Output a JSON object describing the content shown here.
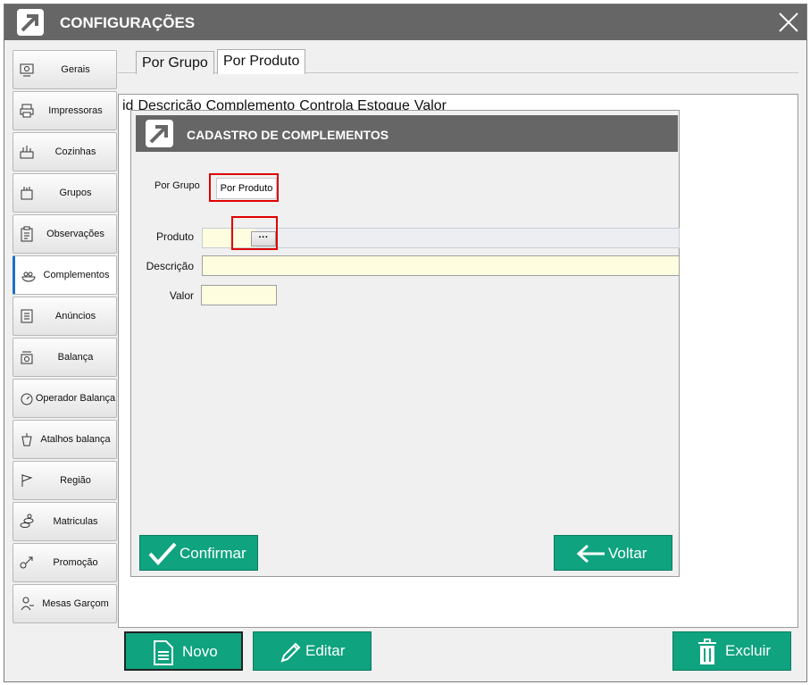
{
  "window": {
    "title": "CONFIGURAÇÕES"
  },
  "sidebar": {
    "items": [
      {
        "label": "Gerais",
        "icon": "settings-panel-icon"
      },
      {
        "label": "Impressoras",
        "icon": "printer-icon"
      },
      {
        "label": "Cozinhas",
        "icon": "kitchen-icon"
      },
      {
        "label": "Grupos",
        "icon": "groups-icon"
      },
      {
        "label": "Observações",
        "icon": "clipboard-icon"
      },
      {
        "label": "Complementos",
        "icon": "dish-icon"
      },
      {
        "label": "Anúncios",
        "icon": "document-icon"
      },
      {
        "label": "Balança",
        "icon": "scale-icon"
      },
      {
        "label": "Operador  Balança",
        "icon": "scale-dial-icon"
      },
      {
        "label": "Atalhos balança",
        "icon": "scale-shortcut-icon"
      },
      {
        "label": "Região",
        "icon": "flag-icon"
      },
      {
        "label": "Matriculas",
        "icon": "coins-icon"
      },
      {
        "label": "Promoção",
        "icon": "promotion-icon"
      },
      {
        "label": "Mesas Garçom",
        "icon": "waiter-icon"
      }
    ],
    "active_index": 5
  },
  "tabs": [
    "Por Grupo",
    "Por Produto"
  ],
  "grid": {
    "columns": [
      "id",
      "Descrição",
      "Complemento",
      "Controla Estoque",
      "Valor"
    ]
  },
  "dialog": {
    "title": "CADASTRO DE COMPLEMENTOS",
    "radio_group_label": "Por Grupo",
    "radio_product_label": "Por Produto",
    "produto_label": "Produto",
    "produto_value": "",
    "ellipsis_label": "···",
    "descricao_label": "Descrição",
    "descricao_value": "",
    "valor_label": "Valor",
    "valor_value": "",
    "confirm_label": "Confirmar",
    "back_label": "Voltar"
  },
  "footer": {
    "novo_label": "Novo",
    "editar_label": "Editar",
    "excluir_label": "Excluir"
  },
  "colors": {
    "titlebar": "#666666",
    "accent_green": "#0fa37f",
    "highlight_red": "#e00000",
    "field_yellow": "#fffde0",
    "active_tab_blue": "#1e6fc4"
  }
}
